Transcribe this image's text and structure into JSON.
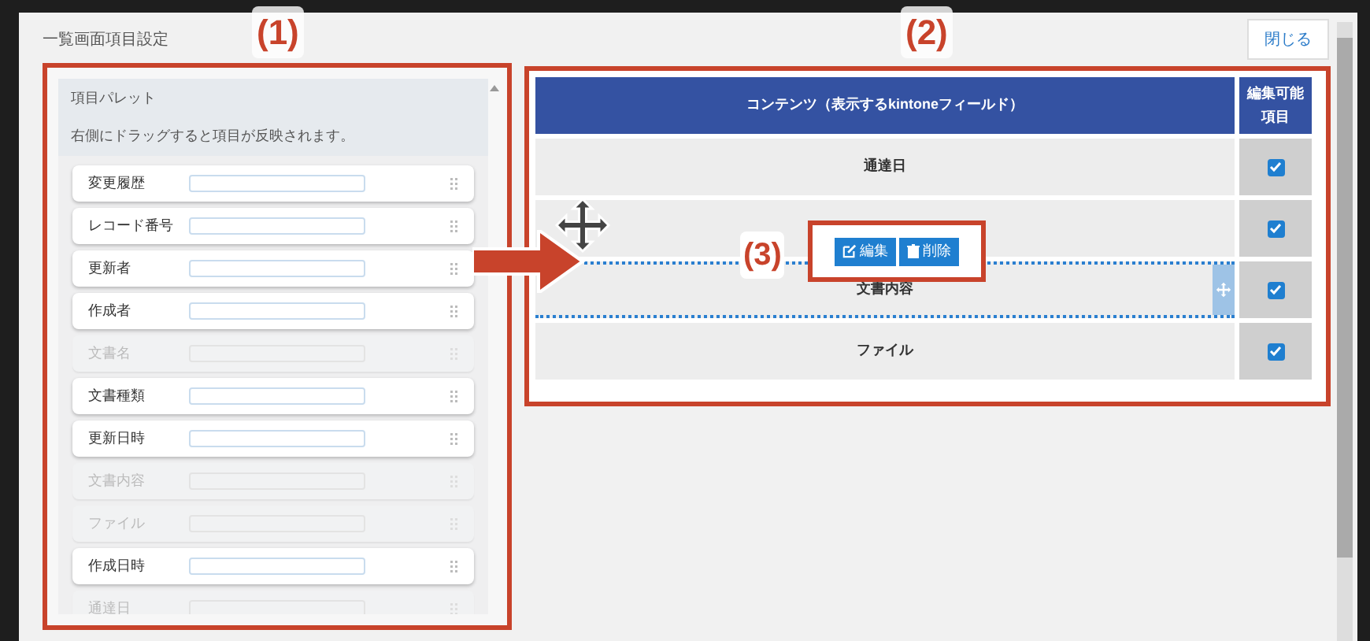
{
  "dialog": {
    "title": "一覧画面項目設定",
    "close_button": "閉じる"
  },
  "palette": {
    "title": "項目パレット",
    "hint": "右側にドラッグすると項目が反映されます。",
    "items": [
      {
        "label": "変更履歴",
        "disabled": false
      },
      {
        "label": "レコード番号",
        "disabled": false
      },
      {
        "label": "更新者",
        "disabled": false
      },
      {
        "label": "作成者",
        "disabled": false
      },
      {
        "label": "文書名",
        "disabled": true
      },
      {
        "label": "文書種類",
        "disabled": false
      },
      {
        "label": "更新日時",
        "disabled": false
      },
      {
        "label": "文書内容",
        "disabled": true
      },
      {
        "label": "ファイル",
        "disabled": true
      },
      {
        "label": "作成日時",
        "disabled": false
      },
      {
        "label": "通達日",
        "disabled": true
      }
    ]
  },
  "table": {
    "columns": [
      "コンテンツ（表示するkintoneフィールド）",
      "編集可能項目"
    ],
    "rows": [
      {
        "label": "通達日",
        "editable": true,
        "dragging": false
      },
      {
        "editable": true,
        "dragging": false
      },
      {
        "label": "文書内容",
        "editable": true,
        "dragging": true
      },
      {
        "label": "ファイル",
        "editable": true,
        "dragging": false
      }
    ]
  },
  "row_actions": [
    "編集",
    "削除"
  ],
  "annotations": [
    "(1)",
    "(2)",
    "(3)"
  ]
}
